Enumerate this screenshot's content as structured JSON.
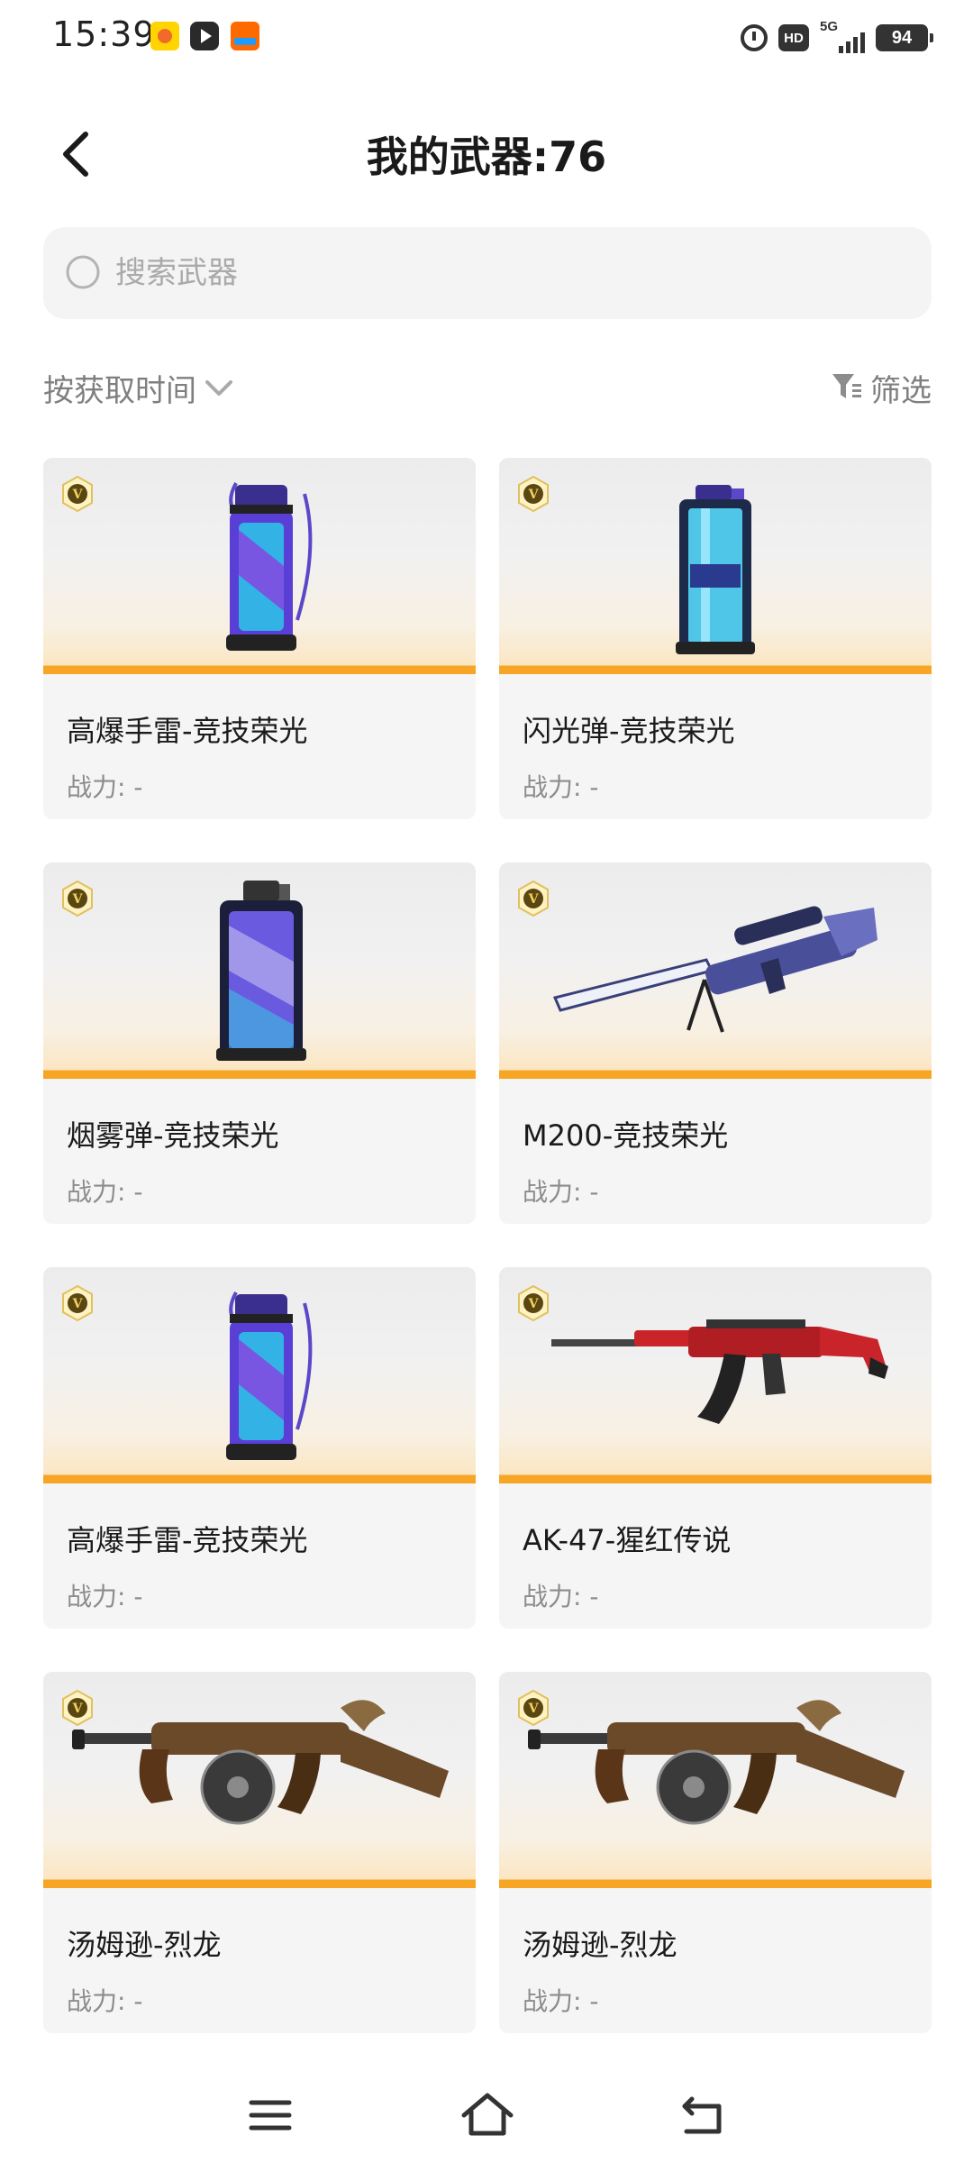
{
  "status_bar": {
    "time": "15:39",
    "hd": "HD",
    "network": "5G",
    "battery": "94"
  },
  "header": {
    "title": "我的武器:76"
  },
  "search": {
    "placeholder": "搜索武器",
    "value": ""
  },
  "sort": {
    "label": "按获取时间"
  },
  "filter": {
    "label": "筛选"
  },
  "weapons": [
    {
      "name": "高爆手雷-竞技荣光",
      "power": "战力: -",
      "icon": "he-grenade-icon"
    },
    {
      "name": "闪光弹-竞技荣光",
      "power": "战力: -",
      "icon": "flashbang-icon"
    },
    {
      "name": "烟雾弹-竞技荣光",
      "power": "战力: -",
      "icon": "smoke-grenade-icon"
    },
    {
      "name": "M200-竞技荣光",
      "power": "战力: -",
      "icon": "sniper-rifle-icon"
    },
    {
      "name": "高爆手雷-竞技荣光",
      "power": "战力: -",
      "icon": "he-grenade-icon"
    },
    {
      "name": "AK-47-猩红传说",
      "power": "战力: -",
      "icon": "assault-rifle-icon"
    },
    {
      "name": "汤姆逊-烈龙",
      "power": "战力: -",
      "icon": "tommy-gun-icon"
    },
    {
      "name": "汤姆逊-烈龙",
      "power": "战力: -",
      "icon": "tommy-gun-icon"
    }
  ],
  "badge": {
    "letter": "V",
    "icon": "vip-badge-icon"
  },
  "colors": {
    "accent_orange": "#f6a524",
    "card_bg": "#f5f5f5",
    "muted_text": "#8c8c8c",
    "badge_gold": "#c9a227"
  },
  "nav_bar": {
    "menu_icon": "menu-icon",
    "home_icon": "home-icon",
    "back_icon": "back-icon"
  }
}
